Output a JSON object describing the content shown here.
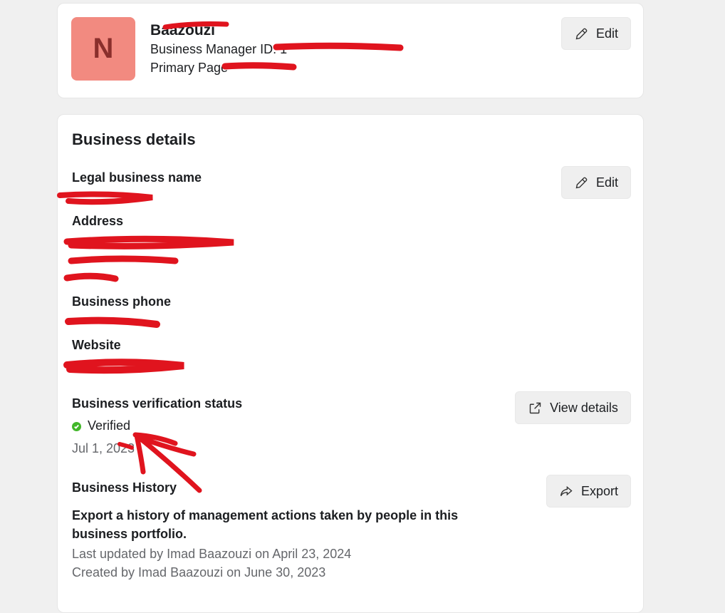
{
  "profile": {
    "initial": "N",
    "name": "Baazouzi",
    "manager_id_label": "Business Manager ID: 1",
    "primary_page_label": "Primary Page",
    "edit_label": "Edit"
  },
  "details": {
    "heading": "Business details",
    "edit_label": "Edit",
    "legal_name_label": "Legal business name",
    "address_label": "Address",
    "phone_label": "Business phone",
    "website_label": "Website",
    "verification_label": "Business verification status",
    "verification_status": "Verified",
    "verification_date": "Jul 1, 2023",
    "view_details_label": "View details",
    "history_label": "Business History",
    "history_description": "Export a history of management actions taken by people in this business portfolio.",
    "export_label": "Export",
    "last_updated": "Last updated by Imad Baazouzi on April 23, 2024",
    "created": "Created by Imad Baazouzi on June 30, 2023"
  },
  "colors": {
    "background": "#f0f0f0",
    "card": "#ffffff",
    "avatar": "#f28a80",
    "verified": "#42b72a",
    "redaction": "#e0141e"
  },
  "icons": [
    "pencil-icon",
    "external-link-icon",
    "share-arrow-icon",
    "check-icon"
  ]
}
